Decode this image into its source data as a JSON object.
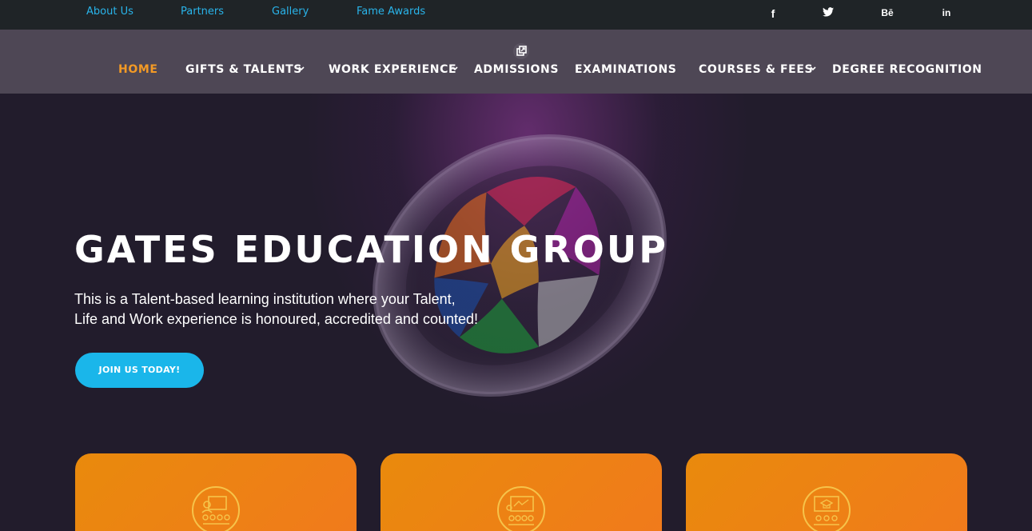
{
  "topbar": {
    "links": [
      "About Us",
      "Partners",
      "Gallery",
      "Fame Awards"
    ],
    "social": [
      {
        "label": "f",
        "icon": "facebook-icon"
      },
      {
        "label": "twitter",
        "icon": "twitter-icon"
      },
      {
        "label": "Bē",
        "icon": "behance-icon"
      },
      {
        "label": "in",
        "icon": "linkedin-icon"
      }
    ]
  },
  "nav": {
    "items": [
      "HOME",
      "GIFTS & TALENTS",
      "WORK EXPERIENCE",
      "ADMISSIONS",
      "EXAMINATIONS",
      "COURSES & FEES",
      "DEGREE RECOGNITION"
    ],
    "active": "HOME",
    "active_color": "#f39a25"
  },
  "hero": {
    "title": "GATES EDUCATION GROUP",
    "line1": "This is a Talent-based learning institution where your Talent,",
    "line2": "Life and Work experience is honoured, accredited and counted!",
    "cta": "JOIN US TODAY!",
    "cta_color": "#1ab6ea"
  },
  "cards": [
    {
      "icon": "presentation-audience-icon"
    },
    {
      "icon": "classroom-board-icon"
    },
    {
      "icon": "graduation-screen-icon"
    }
  ],
  "colors": {
    "topbar_link": "#29b4ea",
    "card": "#ec840f"
  }
}
